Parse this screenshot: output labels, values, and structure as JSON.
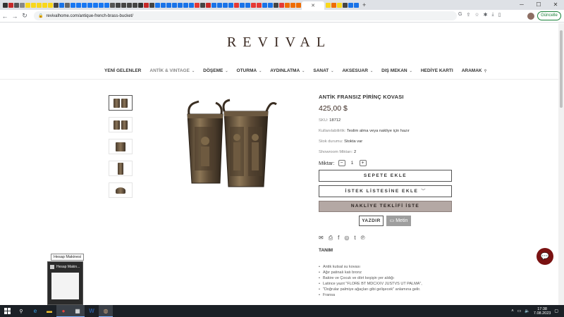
{
  "browser": {
    "url": "revivalhome.com/antique-french-brass-bucket/",
    "update_label": "Güncelle",
    "tab_favicon_colors": [
      "#333",
      "#c62828",
      "#555",
      "#888",
      "#f9d71c",
      "#f9d71c",
      "#f9d71c",
      "#f9d71c",
      "#f9d71c",
      "#444",
      "#1a73e8",
      "#666",
      "#1877f2",
      "#1877f2",
      "#1877f2",
      "#1877f2",
      "#1877f2",
      "#1877f2",
      "#1877f2",
      "#555",
      "#444",
      "#444",
      "#444",
      "#444",
      "#333",
      "#c62828",
      "#444",
      "#1877f2",
      "#1a73e8",
      "#1a73e8",
      "#1a73e8",
      "#1a73e8",
      "#1a73e8",
      "#1a73e8",
      "#e53935",
      "#444",
      "#c62828",
      "#1a73e8",
      "#1a73e8",
      "#1a73e8",
      "#1a73e8",
      "#e53935",
      "#1a73e8",
      "#1a73e8",
      "#e53935",
      "#e53935",
      "#1a73e8",
      "#1a73e8",
      "#444",
      "#e53935",
      "#ef6c00",
      "#ef6c00",
      "#ef6c00",
      "#f9d71c",
      "#ef6c00",
      "#f9d71c",
      "#444",
      "#1a73e8",
      "#1a73e8"
    ]
  },
  "site": {
    "logo": "REVIVAL",
    "nav": [
      {
        "label": "YENİ GELENLER",
        "chevron": false,
        "muted": false
      },
      {
        "label": "ANTİK & VINTAGE",
        "chevron": true,
        "muted": true
      },
      {
        "label": "DÖŞEME",
        "chevron": true,
        "muted": false
      },
      {
        "label": "OTURMA",
        "chevron": true,
        "muted": false
      },
      {
        "label": "AYDINLATMA",
        "chevron": true,
        "muted": false
      },
      {
        "label": "SANAT",
        "chevron": true,
        "muted": false
      },
      {
        "label": "AKSESUAR",
        "chevron": true,
        "muted": false
      },
      {
        "label": "DIŞ MEKAN",
        "chevron": true,
        "muted": false
      },
      {
        "label": "HEDİYE KARTI",
        "chevron": false,
        "muted": false
      },
      {
        "label": "ARAMAK",
        "chevron": false,
        "muted": false
      }
    ]
  },
  "product": {
    "title": "ANTİK FRANSIZ PİRİNÇ KOVASI",
    "price": "425,00 $",
    "sku_label": "SKU:",
    "sku": "18712",
    "availability_label": "Kullanılabilirlik:",
    "availability": "Teslim alma veya nakliye için hazır",
    "stock_label": "Stok durumu:",
    "stock": "Stokta var",
    "showroom_label": "Showroom Miktarı:",
    "showroom": "2",
    "qty_label": "Miktar:",
    "qty_minus": "−",
    "qty_value": "1",
    "qty_plus": "+",
    "add_to_cart": "SEPETE EKLE",
    "wishlist": "İSTEK LİSTESİNE EKLE",
    "shipping_quote": "NAKLİYE TEKLİFİ İSTE",
    "print": "YAZDIR",
    "note": "Metin",
    "tab_label": "TANIM",
    "description": [
      "Antik kutsal su kovası",
      "Ağır patinalı katı bronz",
      "Bakire ve Çocuk ve dört keşişin yer aldığı",
      "Latince yazıt \"FLORE BT MDCXXV JUSTVS UT PALMA\",",
      "\"Doğrular palmiye ağaçları gibi gelişecek\" anlamına gelir.",
      "Fransa"
    ]
  },
  "taskbar": {
    "tooltip": "Hesap Makinesi",
    "preview_title": "Hesap Makin...",
    "time": "17:38",
    "date": "7.08.2023"
  }
}
